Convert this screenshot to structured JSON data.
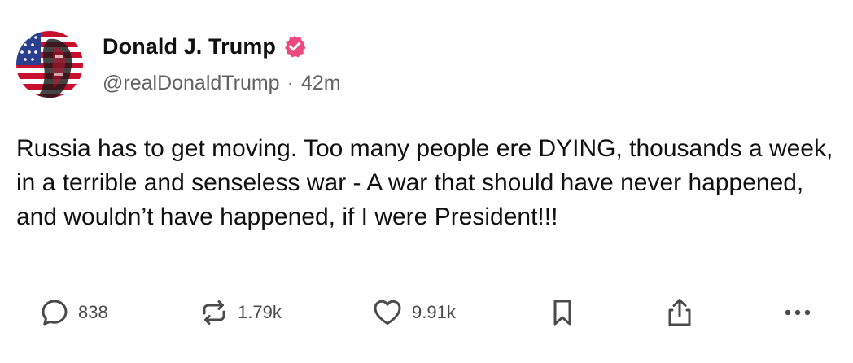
{
  "author": {
    "display_name": "Donald J. Trump",
    "handle": "@realDonaldTrump",
    "separator": "·",
    "timestamp": "42m",
    "verified": true,
    "verified_icon": "verified-badge-icon",
    "verified_color": "#ec4a7f"
  },
  "post": {
    "text": "Russia has to get moving. Too many people ere DYING, thousands a week, in a terrible and senseless war - A war that should have never happened, and wouldn’t have happened, if I were President!!!"
  },
  "actions": {
    "reply": {
      "icon": "comment-icon",
      "count": "838"
    },
    "repost": {
      "icon": "repost-icon",
      "count": "1.79k"
    },
    "like": {
      "icon": "heart-icon",
      "count": "9.91k"
    },
    "bookmark": {
      "icon": "bookmark-icon"
    },
    "share": {
      "icon": "share-icon"
    },
    "more": {
      "icon": "more-dots-icon"
    }
  },
  "colors": {
    "text": "#111111",
    "muted": "#616161",
    "icon": "#4a4a4a",
    "flag_red": "#c8102e",
    "flag_blue": "#2a3f8f"
  }
}
